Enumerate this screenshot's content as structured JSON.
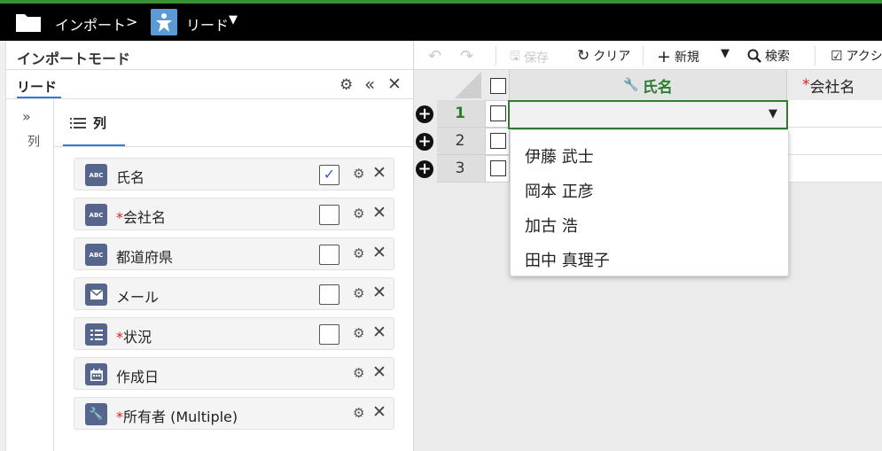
{
  "breadcrumb": {
    "folder_label": "インポート",
    "separator": ">",
    "object_label": "リード",
    "caret": "▼"
  },
  "panel": {
    "title": "インポートモード",
    "tab": "リード",
    "rail_label": "列",
    "columns_tab": "列",
    "fields": [
      {
        "icon": "abc-icon",
        "icon_text": "ABC",
        "label": "氏名",
        "required": false,
        "has_checkbox": true,
        "checked": true
      },
      {
        "icon": "abc-icon",
        "icon_text": "ABC",
        "label": "会社名",
        "required": true,
        "has_checkbox": true,
        "checked": false
      },
      {
        "icon": "abc-icon",
        "icon_text": "ABC",
        "label": "都道府県",
        "required": false,
        "has_checkbox": true,
        "checked": false
      },
      {
        "icon": "email-icon",
        "icon_text": "",
        "label": "メール",
        "required": false,
        "has_checkbox": true,
        "checked": false
      },
      {
        "icon": "picklist-icon",
        "icon_text": "",
        "label": "状況",
        "required": true,
        "has_checkbox": true,
        "checked": false
      },
      {
        "icon": "calendar-icon",
        "icon_text": "",
        "label": "作成日",
        "required": false,
        "has_checkbox": false,
        "checked": false
      },
      {
        "icon": "lookup-icon",
        "icon_text": "",
        "label": "所有者 (Multiple)",
        "required": true,
        "has_checkbox": false,
        "checked": false
      }
    ]
  },
  "toolbar": {
    "save": "保存",
    "clear": "クリア",
    "new": "新規",
    "search": "検索",
    "action": "アクシ"
  },
  "grid": {
    "columns": [
      {
        "label": "氏名",
        "active": true
      },
      {
        "label": "会社名",
        "required": true
      }
    ],
    "rows": [
      "1",
      "2",
      "3"
    ],
    "active_row": "1"
  },
  "dropdown": {
    "options": [
      "伊藤 武士",
      "岡本 正彦",
      "加古 浩",
      "田中 真理子"
    ]
  }
}
